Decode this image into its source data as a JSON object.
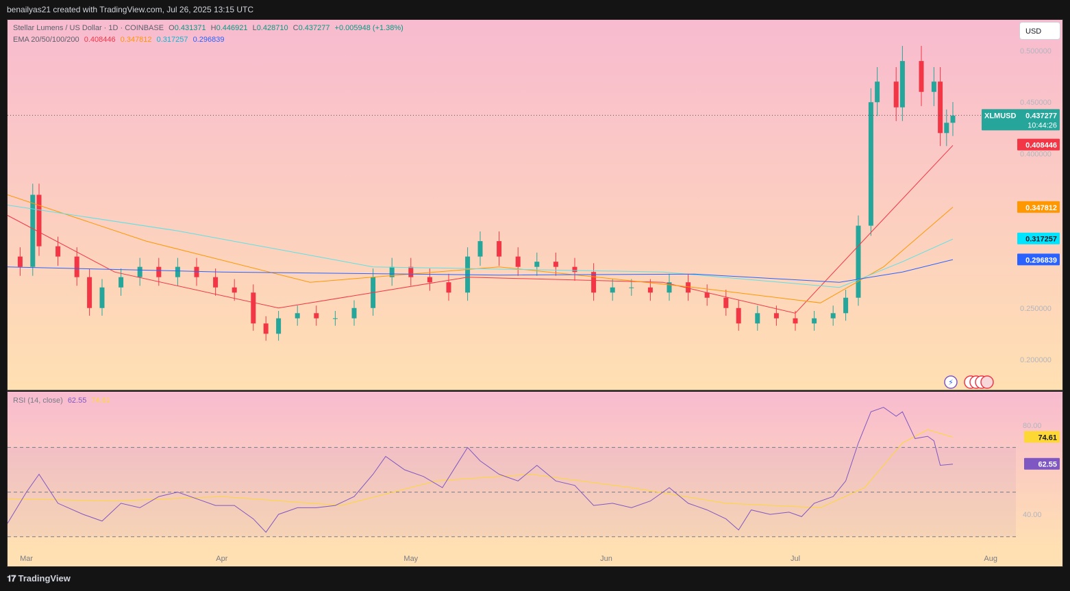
{
  "header": {
    "caption": "benailyas21 created with TradingView.com, Jul 26, 2025 13:15 UTC"
  },
  "legend": {
    "symbol_line": "Stellar Lumens / US Dollar · 1D · COINBASE",
    "o_label": "O",
    "o": "0.431371",
    "h_label": "H",
    "h": "0.446921",
    "l_label": "L",
    "l": "0.428710",
    "c_label": "C",
    "c": "0.437277",
    "change": "+0.005948 (+1.38%)",
    "ema_label": "EMA 20/50/100/200",
    "ema20": "0.408446",
    "ema50": "0.347812",
    "ema100": "0.317257",
    "ema200": "0.296839",
    "rsi_label": "RSI (14, close)",
    "rsi": "62.55",
    "rsi_ma": "74.61"
  },
  "currency_button": "USD",
  "footer": {
    "brand": "TradingView",
    "logo_icon": "tradingview-logo-icon"
  },
  "colors": {
    "up": "#26a69a",
    "down": "#f23645",
    "ema20": "#f23645",
    "ema50": "#ff9800",
    "ema100": "#5ce1e6",
    "ema200": "#2962ff",
    "rsi": "#7e57c2",
    "rsi_ma": "#fdd835"
  },
  "chart_data": {
    "type": "candlestick",
    "symbol": "XLMUSD",
    "price_axis_ticks": [
      "0.500000",
      "0.450000",
      "0.400000",
      "0.250000",
      "0.200000"
    ],
    "price_range": [
      0.17,
      0.53
    ],
    "time_labels": [
      {
        "label": "Mar",
        "date": "2025-03-01"
      },
      {
        "label": "Apr",
        "date": "2025-04-01"
      },
      {
        "label": "May",
        "date": "2025-05-01"
      },
      {
        "label": "Jun",
        "date": "2025-06-01"
      },
      {
        "label": "Jul",
        "date": "2025-07-01"
      },
      {
        "label": "Aug",
        "date": "2025-08-01"
      }
    ],
    "last_price_label": {
      "symbol": "XLMUSD",
      "price": "0.437277",
      "countdown": "10:44:26"
    },
    "ema_labels": [
      {
        "name": "EMA 20",
        "value": "0.408446"
      },
      {
        "name": "EMA 50",
        "value": "0.347812"
      },
      {
        "name": "EMA 100",
        "value": "0.317257"
      },
      {
        "name": "EMA 200",
        "value": "0.296839"
      }
    ],
    "close_points": [
      [
        "2025-02-26",
        0.3
      ],
      [
        "2025-02-28",
        0.29
      ],
      [
        "2025-03-02",
        0.36
      ],
      [
        "2025-03-03",
        0.31
      ],
      [
        "2025-03-06",
        0.3
      ],
      [
        "2025-03-09",
        0.28
      ],
      [
        "2025-03-11",
        0.25
      ],
      [
        "2025-03-13",
        0.27
      ],
      [
        "2025-03-16",
        0.28
      ],
      [
        "2025-03-19",
        0.29
      ],
      [
        "2025-03-22",
        0.28
      ],
      [
        "2025-03-25",
        0.29
      ],
      [
        "2025-03-28",
        0.28
      ],
      [
        "2025-03-31",
        0.27
      ],
      [
        "2025-04-03",
        0.265
      ],
      [
        "2025-04-06",
        0.235
      ],
      [
        "2025-04-08",
        0.225
      ],
      [
        "2025-04-10",
        0.24
      ],
      [
        "2025-04-13",
        0.245
      ],
      [
        "2025-04-16",
        0.24
      ],
      [
        "2025-04-19",
        0.24
      ],
      [
        "2025-04-22",
        0.25
      ],
      [
        "2025-04-25",
        0.28
      ],
      [
        "2025-04-28",
        0.29
      ],
      [
        "2025-05-01",
        0.28
      ],
      [
        "2025-05-04",
        0.275
      ],
      [
        "2025-05-07",
        0.265
      ],
      [
        "2025-05-10",
        0.3
      ],
      [
        "2025-05-12",
        0.315
      ],
      [
        "2025-05-15",
        0.3
      ],
      [
        "2025-05-18",
        0.29
      ],
      [
        "2025-05-21",
        0.295
      ],
      [
        "2025-05-24",
        0.29
      ],
      [
        "2025-05-27",
        0.285
      ],
      [
        "2025-05-30",
        0.265
      ],
      [
        "2025-06-02",
        0.27
      ],
      [
        "2025-06-05",
        0.27
      ],
      [
        "2025-06-08",
        0.265
      ],
      [
        "2025-06-11",
        0.275
      ],
      [
        "2025-06-14",
        0.265
      ],
      [
        "2025-06-17",
        0.26
      ],
      [
        "2025-06-20",
        0.25
      ],
      [
        "2025-06-22",
        0.235
      ],
      [
        "2025-06-25",
        0.245
      ],
      [
        "2025-06-28",
        0.24
      ],
      [
        "2025-07-01",
        0.235
      ],
      [
        "2025-07-04",
        0.24
      ],
      [
        "2025-07-07",
        0.245
      ],
      [
        "2025-07-09",
        0.26
      ],
      [
        "2025-07-11",
        0.33
      ],
      [
        "2025-07-13",
        0.45
      ],
      [
        "2025-07-14",
        0.47
      ],
      [
        "2025-07-17",
        0.445
      ],
      [
        "2025-07-18",
        0.49
      ],
      [
        "2025-07-21",
        0.46
      ],
      [
        "2025-07-23",
        0.47
      ],
      [
        "2025-07-24",
        0.42
      ],
      [
        "2025-07-25",
        0.43
      ],
      [
        "2025-07-26",
        0.437
      ]
    ],
    "ema20_points": [
      [
        "2025-02-26",
        0.34
      ],
      [
        "2025-03-15",
        0.285
      ],
      [
        "2025-04-10",
        0.25
      ],
      [
        "2025-05-10",
        0.28
      ],
      [
        "2025-06-10",
        0.275
      ],
      [
        "2025-07-01",
        0.245
      ],
      [
        "2025-07-14",
        0.33
      ],
      [
        "2025-07-26",
        0.408
      ]
    ],
    "ema50_points": [
      [
        "2025-02-26",
        0.36
      ],
      [
        "2025-03-20",
        0.315
      ],
      [
        "2025-04-15",
        0.275
      ],
      [
        "2025-05-15",
        0.29
      ],
      [
        "2025-06-15",
        0.27
      ],
      [
        "2025-07-05",
        0.255
      ],
      [
        "2025-07-15",
        0.29
      ],
      [
        "2025-07-26",
        0.348
      ]
    ],
    "ema100_points": [
      [
        "2025-02-26",
        0.35
      ],
      [
        "2025-03-25",
        0.325
      ],
      [
        "2025-04-25",
        0.29
      ],
      [
        "2025-06-10",
        0.285
      ],
      [
        "2025-07-08",
        0.27
      ],
      [
        "2025-07-18",
        0.295
      ],
      [
        "2025-07-26",
        0.317
      ]
    ],
    "ema200_points": [
      [
        "2025-02-26",
        0.29
      ],
      [
        "2025-04-01",
        0.285
      ],
      [
        "2025-05-15",
        0.282
      ],
      [
        "2025-06-15",
        0.283
      ],
      [
        "2025-07-08",
        0.275
      ],
      [
        "2025-07-18",
        0.285
      ],
      [
        "2025-07-26",
        0.297
      ]
    ],
    "rsi": {
      "axis_ticks": [
        "80.00",
        "40.00"
      ],
      "levels": [
        70,
        50,
        30
      ],
      "range": [
        25,
        95
      ],
      "current": "62.55",
      "ma_current": "74.61",
      "points": [
        [
          "2025-02-26",
          36
        ],
        [
          "2025-03-01",
          50
        ],
        [
          "2025-03-03",
          58
        ],
        [
          "2025-03-06",
          45
        ],
        [
          "2025-03-10",
          40
        ],
        [
          "2025-03-13",
          37
        ],
        [
          "2025-03-16",
          45
        ],
        [
          "2025-03-19",
          43
        ],
        [
          "2025-03-22",
          48
        ],
        [
          "2025-03-25",
          50
        ],
        [
          "2025-03-28",
          47
        ],
        [
          "2025-03-31",
          44
        ],
        [
          "2025-04-03",
          44
        ],
        [
          "2025-04-06",
          38
        ],
        [
          "2025-04-08",
          32
        ],
        [
          "2025-04-10",
          40
        ],
        [
          "2025-04-13",
          43
        ],
        [
          "2025-04-16",
          43
        ],
        [
          "2025-04-19",
          44
        ],
        [
          "2025-04-22",
          48
        ],
        [
          "2025-04-25",
          58
        ],
        [
          "2025-04-27",
          66
        ],
        [
          "2025-04-30",
          60
        ],
        [
          "2025-05-03",
          57
        ],
        [
          "2025-05-06",
          52
        ],
        [
          "2025-05-08",
          61
        ],
        [
          "2025-05-10",
          70
        ],
        [
          "2025-05-12",
          64
        ],
        [
          "2025-05-15",
          58
        ],
        [
          "2025-05-18",
          55
        ],
        [
          "2025-05-21",
          62
        ],
        [
          "2025-05-24",
          55
        ],
        [
          "2025-05-27",
          53
        ],
        [
          "2025-05-30",
          44
        ],
        [
          "2025-06-02",
          45
        ],
        [
          "2025-06-05",
          43
        ],
        [
          "2025-06-08",
          46
        ],
        [
          "2025-06-11",
          52
        ],
        [
          "2025-06-14",
          45
        ],
        [
          "2025-06-17",
          42
        ],
        [
          "2025-06-20",
          38
        ],
        [
          "2025-06-22",
          33
        ],
        [
          "2025-06-24",
          42
        ],
        [
          "2025-06-27",
          40
        ],
        [
          "2025-06-30",
          41
        ],
        [
          "2025-07-02",
          39
        ],
        [
          "2025-07-04",
          45
        ],
        [
          "2025-07-07",
          48
        ],
        [
          "2025-07-09",
          55
        ],
        [
          "2025-07-11",
          72
        ],
        [
          "2025-07-13",
          86
        ],
        [
          "2025-07-15",
          88
        ],
        [
          "2025-07-17",
          84
        ],
        [
          "2025-07-18",
          86
        ],
        [
          "2025-07-20",
          74
        ],
        [
          "2025-07-22",
          75
        ],
        [
          "2025-07-23",
          73
        ],
        [
          "2025-07-24",
          62
        ],
        [
          "2025-07-26",
          62.55
        ]
      ],
      "ma_points": [
        [
          "2025-02-26",
          47
        ],
        [
          "2025-03-15",
          46
        ],
        [
          "2025-04-01",
          48
        ],
        [
          "2025-04-20",
          44
        ],
        [
          "2025-05-05",
          55
        ],
        [
          "2025-05-20",
          58
        ],
        [
          "2025-06-05",
          52
        ],
        [
          "2025-06-20",
          45
        ],
        [
          "2025-07-05",
          43
        ],
        [
          "2025-07-12",
          52
        ],
        [
          "2025-07-18",
          72
        ],
        [
          "2025-07-22",
          78
        ],
        [
          "2025-07-26",
          74.61
        ]
      ]
    }
  }
}
